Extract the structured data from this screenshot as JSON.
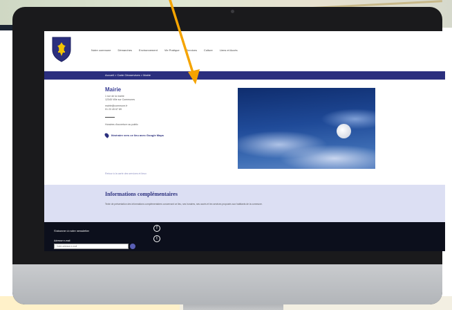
{
  "colors": {
    "brand_blue": "#2b2f7e",
    "arrow": "#f5a400",
    "info_bg": "#dcdff3",
    "footer_bg": "#0c0f1c"
  },
  "site": {
    "nav": [
      "Notre commune",
      "Démarches",
      "Environnement",
      "Vie Pratique",
      "Services",
      "Culture",
      "Liens et Accès"
    ],
    "breadcrumb": "Accueil > Carte Géoservices > Mairie",
    "mairie": {
      "title": "Mairie",
      "address_line1": "1 rue de la mairie",
      "address_line2": "12345 Ville sur Communes",
      "email": "mairie@commune.fr",
      "phone": "01 23 45 67 89",
      "hours": "Horaires d'ouverture au public",
      "map_link": "Itinéraire vers ce lieu avec Google Maps",
      "back_link": "Retour à la carte des services et lieux"
    },
    "info": {
      "title": "Informations complémentaires",
      "text": "Texte de présentation des informations complémentaires concernant ce lieu, ses horaires, ses accès et les services proposés aux habitants de la commune."
    },
    "footer": {
      "title": "S'abonner à notre newsletter",
      "field_label": "Adresse e-mail",
      "select_placeholder": "Votre adresse e-mail",
      "social_icons": [
        "facebook-icon",
        "twitter-icon"
      ]
    }
  }
}
